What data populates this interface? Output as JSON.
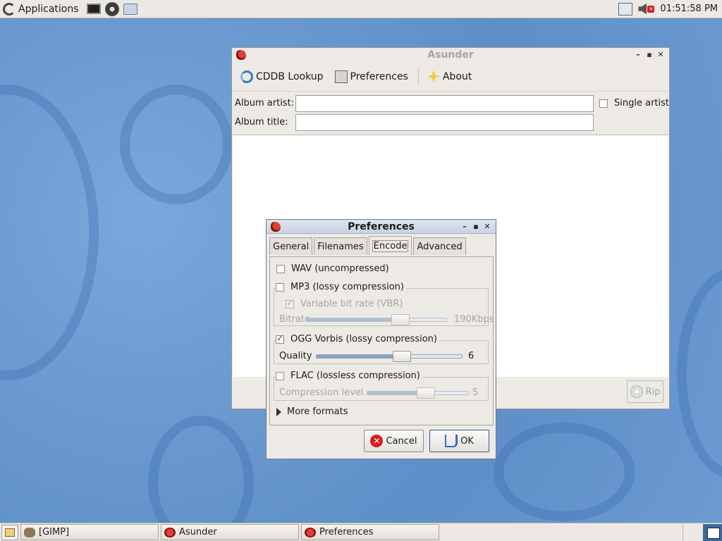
{
  "top_panel": {
    "applications_label": "Applications",
    "launchers": [
      {
        "icon": "terminal-icon"
      },
      {
        "icon": "cd-ripper-icon"
      },
      {
        "icon": "screenshot-icon"
      }
    ],
    "tray_icons": [
      "network-icon",
      "volume-muted-icon"
    ],
    "clock": "01:51:58 PM"
  },
  "asunder": {
    "title": "Asunder",
    "toolbar": {
      "cddb_label": "CDDB Lookup",
      "preferences_label": "Preferences",
      "about_label": "About"
    },
    "album_artist_label": "Album artist:",
    "album_artist_value": "",
    "album_title_label": "Album title:",
    "album_title_value": "",
    "single_artist_label": "Single artist",
    "single_artist_checked": false,
    "rip_label": "Rip"
  },
  "preferences": {
    "title": "Preferences",
    "tabs": [
      {
        "label": "General"
      },
      {
        "label": "Filenames"
      },
      {
        "label": "Encode",
        "active": true
      },
      {
        "label": "Advanced"
      }
    ],
    "encode": {
      "wav_label": "WAV (uncompressed)",
      "wav_checked": false,
      "mp3_label": "MP3 (lossy compression)",
      "mp3_checked": false,
      "vbr_label": "Variable bit rate (VBR)",
      "vbr_checked": true,
      "bitrate_label": "Bitrate",
      "bitrate_value": "190Kbps",
      "bitrate_fraction": 0.7,
      "ogg_label": "OGG Vorbis (lossy compression)",
      "ogg_checked": true,
      "quality_label": "Quality",
      "quality_value": "6",
      "quality_fraction": 0.6,
      "flac_label": "FLAC (lossless compression)",
      "flac_checked": false,
      "compression_label": "Compression level",
      "compression_value": "5",
      "compression_fraction": 0.6,
      "more_formats_label": "More formats"
    },
    "cancel_label": "Cancel",
    "ok_label": "OK"
  },
  "taskbar": {
    "tasks": [
      {
        "label": "[GIMP]"
      },
      {
        "label": "Asunder"
      },
      {
        "label": "Preferences"
      }
    ]
  }
}
